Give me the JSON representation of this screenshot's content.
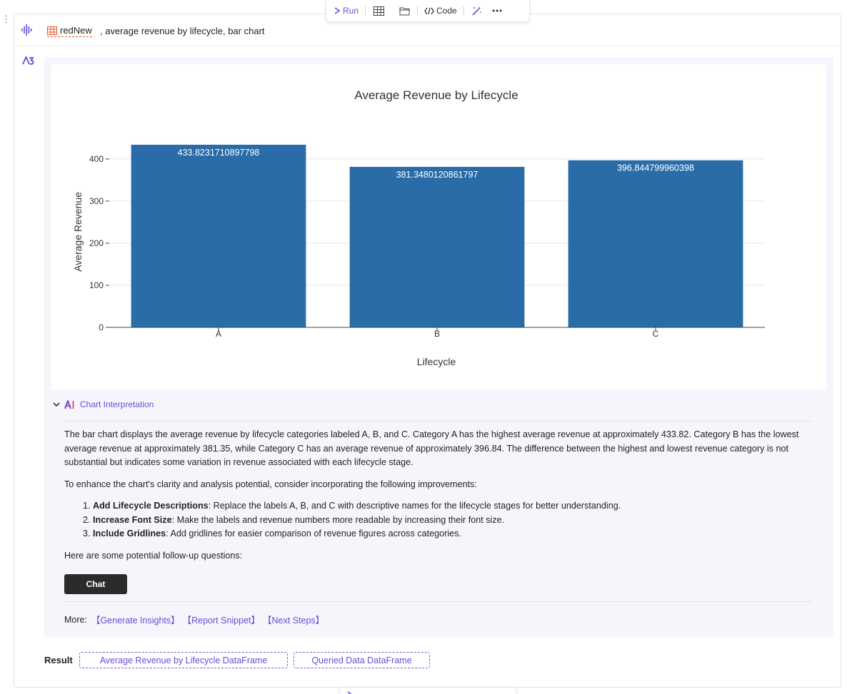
{
  "toolbar": {
    "run_label": "Run",
    "code_label": "Code"
  },
  "prompt": {
    "table_name": "redNew",
    "text": ", average revenue by lifecycle, bar chart"
  },
  "chart_data": {
    "type": "bar",
    "title": "Average Revenue by Lifecycle",
    "xlabel": "Lifecycle",
    "ylabel": "Average Revenue",
    "categories": [
      "A",
      "B",
      "C"
    ],
    "values": [
      433.8231710897798,
      381.3480120861797,
      396.844799960398
    ],
    "value_labels": [
      "433.8231710897798",
      "381.3480120861797",
      "396.844799960398"
    ],
    "ylim": [
      0,
      450
    ],
    "yticks": [
      0,
      100,
      200,
      300,
      400
    ],
    "ytick_labels": [
      "0",
      "100",
      "200",
      "300",
      "400"
    ],
    "bar_color": "#2a6ca8",
    "grid": true
  },
  "interpretation": {
    "header": "Chart Interpretation",
    "paragraph1": "The bar chart displays the average revenue by lifecycle categories labeled A, B, and C. Category A has the highest average revenue at approximately 433.82. Category B has the lowest average revenue at approximately 381.35, while Category C has an average revenue of approximately 396.84. The difference between the highest and lowest revenue category is not substantial but indicates some variation in revenue associated with each lifecycle stage.",
    "paragraph2": "To enhance the chart's clarity and analysis potential, consider incorporating the following improvements:",
    "items": [
      {
        "bold": "Add Lifecycle Descriptions",
        "text": ": Replace the labels A, B, and C with descriptive names for the lifecycle stages for better understanding."
      },
      {
        "bold": "Increase Font Size",
        "text": ": Make the labels and revenue numbers more readable by increasing their font size."
      },
      {
        "bold": "Include Gridlines",
        "text": ": Add gridlines for easier comparison of revenue figures across categories."
      }
    ],
    "followup": "Here are some potential follow-up questions:"
  },
  "chat_button": "Chat",
  "more": {
    "label": "More:",
    "links": [
      "【Generate Insights】",
      "【Report Snippet】",
      "【Next Steps】"
    ]
  },
  "result": {
    "label": "Result",
    "chips": [
      "Average Revenue by Lifecycle DataFrame",
      "Queried Data DataFrame"
    ]
  },
  "colors": {
    "accent": "#6d4ad8",
    "panel_bg": "#f6f5fc"
  }
}
